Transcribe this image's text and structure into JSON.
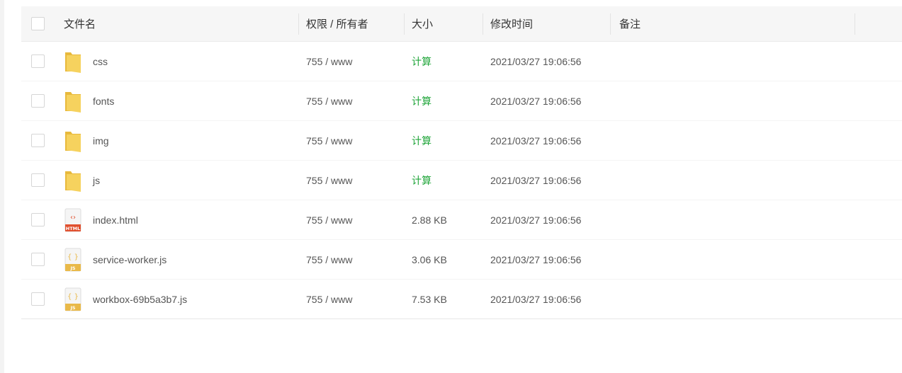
{
  "header": {
    "col_name": "文件名",
    "col_perm": "权限 / 所有者",
    "col_size": "大小",
    "col_time": "修改时间",
    "col_note": "备注"
  },
  "files": [
    {
      "name": "css",
      "type": "folder",
      "icon": "folder-icon",
      "perm": "755 / www",
      "size": "计算",
      "time": "2021/03/27 19:06:56"
    },
    {
      "name": "fonts",
      "type": "folder",
      "icon": "folder-icon",
      "perm": "755 / www",
      "size": "计算",
      "time": "2021/03/27 19:06:56"
    },
    {
      "name": "img",
      "type": "folder",
      "icon": "folder-icon",
      "perm": "755 / www",
      "size": "计算",
      "time": "2021/03/27 19:06:56"
    },
    {
      "name": "js",
      "type": "folder",
      "icon": "folder-icon",
      "perm": "755 / www",
      "size": "计算",
      "time": "2021/03/27 19:06:56"
    },
    {
      "name": "index.html",
      "type": "html",
      "icon": "html-file-icon",
      "icon_label": "HTML",
      "perm": "755 / www",
      "size": "2.88 KB",
      "time": "2021/03/27 19:06:56"
    },
    {
      "name": "service-worker.js",
      "type": "js",
      "icon": "js-file-icon",
      "icon_label": "JS",
      "perm": "755 / www",
      "size": "3.06 KB",
      "time": "2021/03/27 19:06:56"
    },
    {
      "name": "workbox-69b5a3b7.js",
      "type": "js",
      "icon": "js-file-icon",
      "icon_label": "JS",
      "perm": "755 / www",
      "size": "7.53 KB",
      "time": "2021/03/27 19:06:56"
    }
  ],
  "colors": {
    "folder": "#f6d25e",
    "html": "#e0502f",
    "js": "#e9b949",
    "calc_link": "#20a53a"
  }
}
